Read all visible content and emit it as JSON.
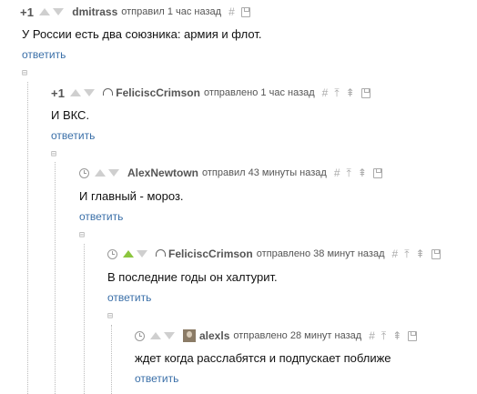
{
  "tools": {
    "hash": "#",
    "up": "⤒",
    "parent": "⇞"
  },
  "collapse_symbol": "⊟",
  "reply_label": "ответить",
  "comments": [
    {
      "rating": "+1",
      "author": "dmitrass",
      "meta": "отправил 1 час назад",
      "text": "У России есть два союзника: армия и флот."
    },
    {
      "rating": "+1",
      "author": "FeliciscCrimson",
      "meta": "отправлено 1 час назад",
      "text": "И ВКС."
    },
    {
      "rating": "",
      "author": "AlexNewtown",
      "meta": "отправил 43 минуты назад",
      "text": "И главный - мороз."
    },
    {
      "rating": "",
      "author": "FeliciscCrimson",
      "meta": "отправлено 38 минут назад",
      "text": "В последние годы он халтурит.",
      "upvoted": true
    },
    {
      "rating": "",
      "author": "alexls",
      "meta": "отправлено 28 минут назад",
      "text": "ждет когда расслабятся и подпускает поближе"
    }
  ]
}
